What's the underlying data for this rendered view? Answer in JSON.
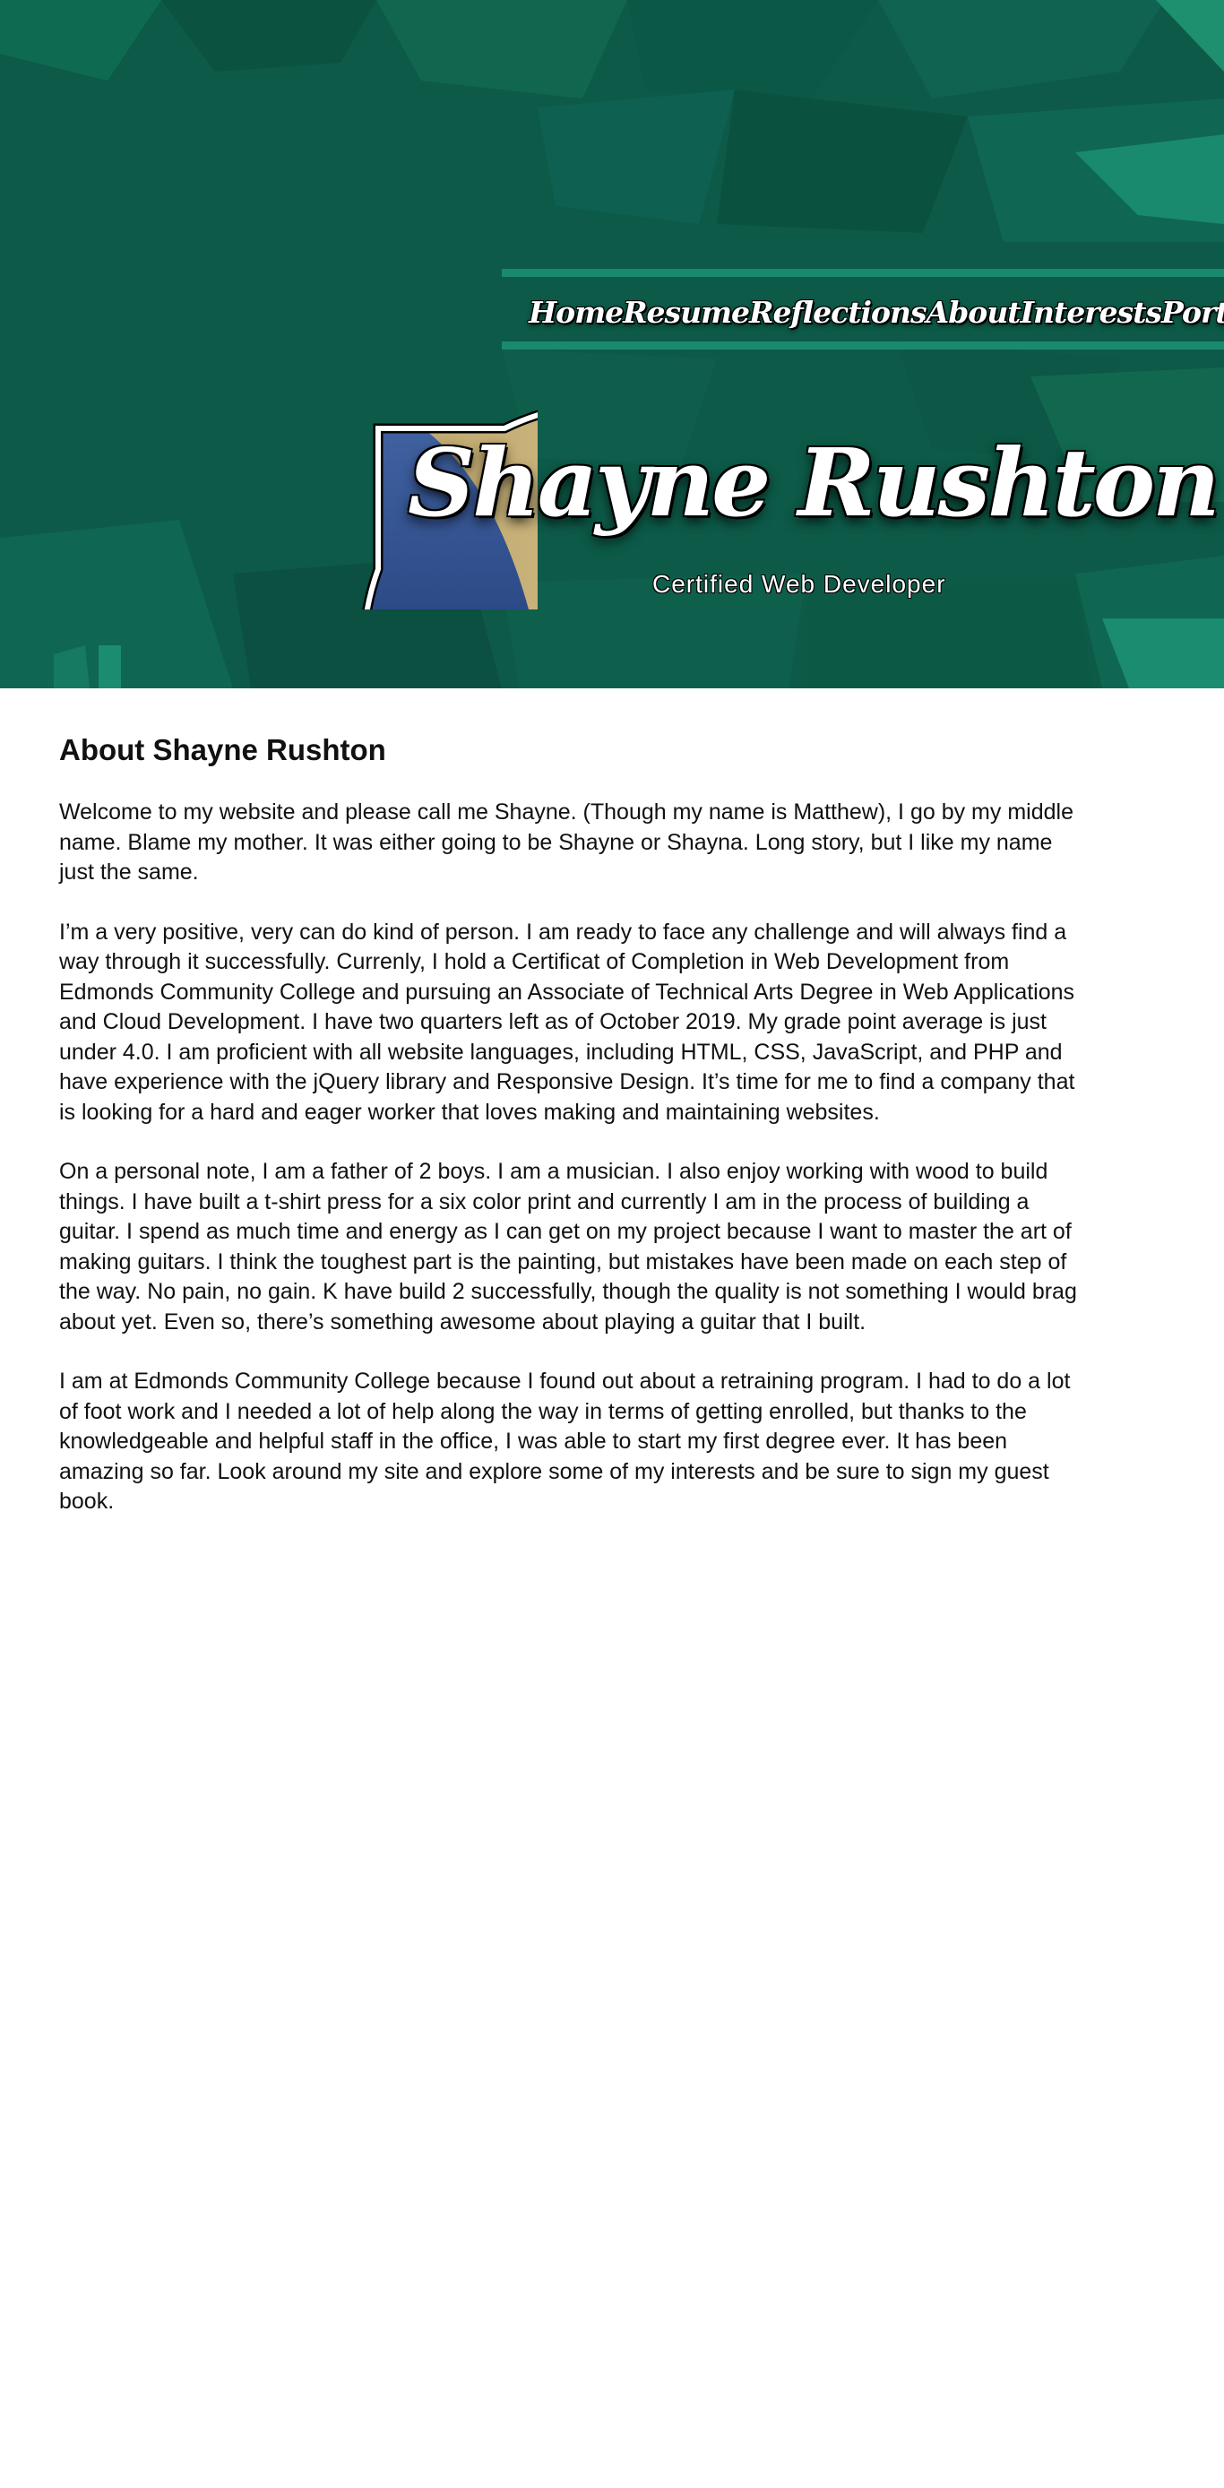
{
  "colors": {
    "header_background": "#0d5a48",
    "header_accent": "#1a8a6c",
    "nav_text": "#ffffff",
    "body_text": "#111111",
    "page_background": "#ffffff"
  },
  "nav": {
    "items": [
      {
        "label": "Home"
      },
      {
        "label": "Resume"
      },
      {
        "label": "Reflections"
      },
      {
        "label": "About"
      },
      {
        "label": "Interests"
      },
      {
        "label": "Portfolio"
      }
    ]
  },
  "brand": {
    "name": "Shayne Rushton",
    "tagline": "Certified Web Developer"
  },
  "portrait": {
    "icon": "profile-photo"
  },
  "main": {
    "heading": "About Shayne Rushton",
    "paragraphs": [
      "Welcome to my website and please call me Shayne. (Though my name is Matthew), I go by my middle name. Blame my mother. It was either going to be Shayne or Shayna. Long story, but I like my name just the same.",
      "I’m a very positive, very can do kind of person. I am ready to face any challenge and will always find a way through it successfully. Currenly, I hold a Certificat of Completion in Web Development from Edmonds Community College and pursuing an Associate of Technical Arts Degree in Web Applications and Cloud Development. I have two quarters left as of October 2019. My grade point average is just under 4.0. I am proficient with all website languages, including HTML, CSS, JavaScript, and PHP and have experience with the jQuery library and Responsive Design. It’s time for me to find a company that is looking for a hard and eager worker that loves making and maintaining websites.",
      "On a personal note, I am a father of 2 boys. I am a musician. I also enjoy working with wood to build things. I have built a t-shirt press for a six color print and currently I am in the process of building a guitar. I spend as much time and energy as I can get on my project because I want to master the art of making guitars. I think the toughest part is the painting, but mistakes have been made on each step of the way. No pain, no gain. K have build 2 successfully, though the quality is not something I would brag about yet. Even so, there’s something awesome about playing a guitar that I built.",
      "I am at Edmonds Community College because I found out about a retraining program. I had to do a lot of foot work and I needed a lot of help along the way  in terms of getting enrolled, but thanks to the knowledgeable and helpful staff in the office, I was able to start my first degree ever. It has been amazing so far. Look around my site and explore some of my interests and be sure to sign my guest book."
    ]
  }
}
